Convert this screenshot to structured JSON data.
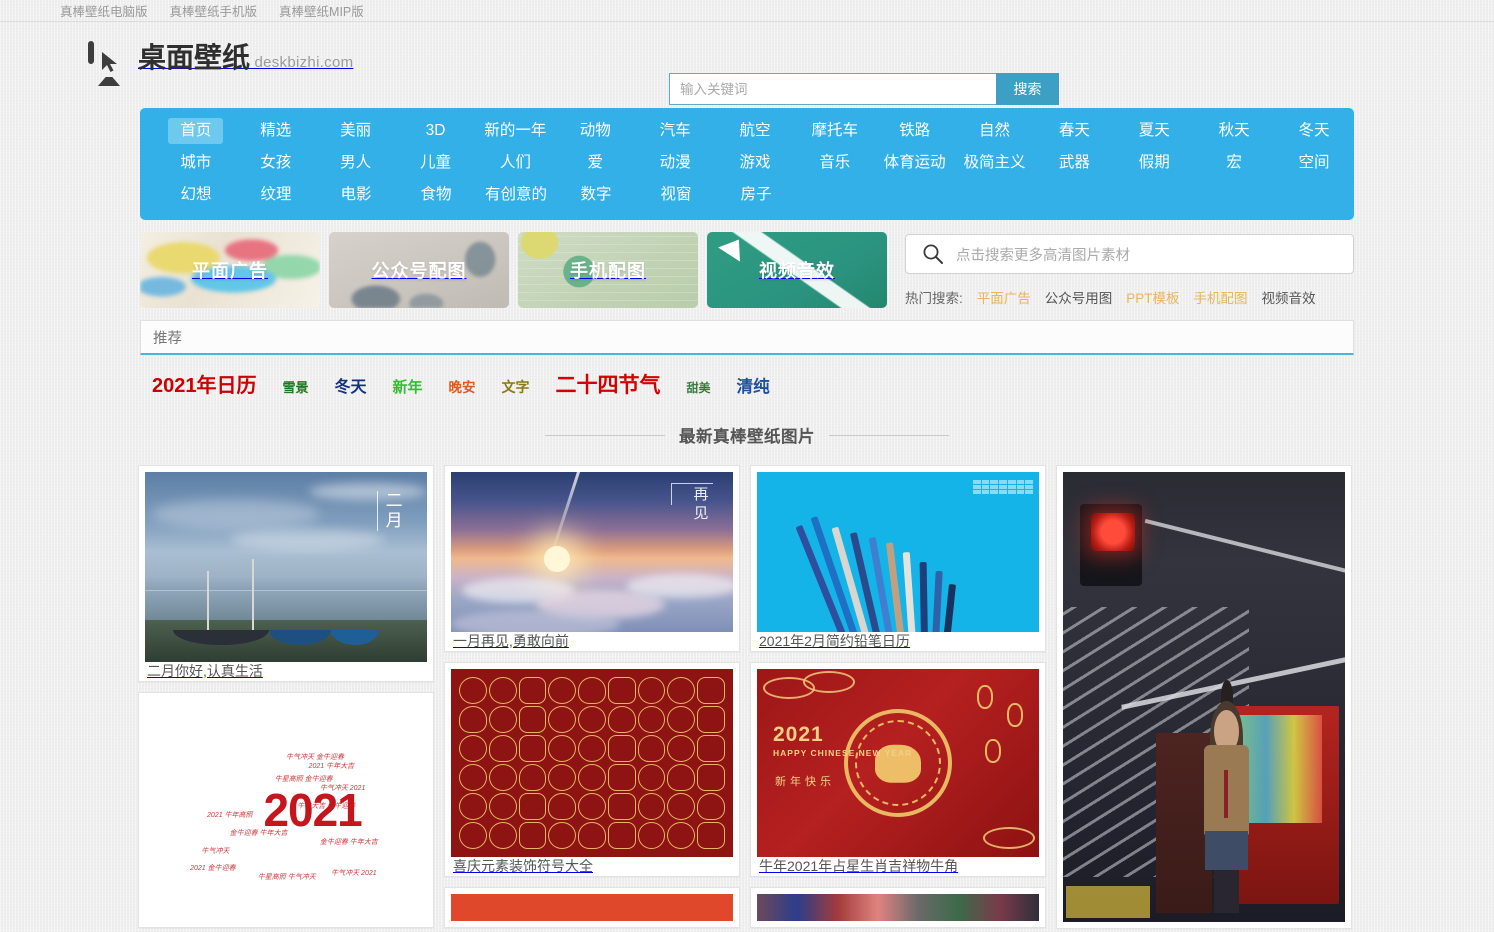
{
  "topbar": {
    "links": [
      {
        "label": "真棒壁纸电脑版"
      },
      {
        "label": "真棒壁纸手机版"
      },
      {
        "label": "真棒壁纸MIP版"
      }
    ]
  },
  "header": {
    "logo_title": "桌面壁纸",
    "logo_sub": "deskbizhi.com",
    "search": {
      "placeholder": "输入关键词",
      "value": "",
      "button_label": "搜索"
    }
  },
  "nav": {
    "rows": [
      [
        {
          "label": "首页",
          "active": true
        },
        {
          "label": "精选",
          "active": false
        },
        {
          "label": "美丽",
          "active": false
        },
        {
          "label": "3D",
          "active": false
        },
        {
          "label": "新的一年",
          "active": false
        },
        {
          "label": "动物",
          "active": false
        },
        {
          "label": "汽车",
          "active": false
        },
        {
          "label": "航空",
          "active": false
        },
        {
          "label": "摩托车",
          "active": false
        },
        {
          "label": "铁路",
          "active": false
        },
        {
          "label": "自然",
          "active": false
        },
        {
          "label": "春天",
          "active": false
        },
        {
          "label": "夏天",
          "active": false
        },
        {
          "label": "秋天",
          "active": false
        },
        {
          "label": "冬天",
          "active": false
        }
      ],
      [
        {
          "label": "城市",
          "active": false
        },
        {
          "label": "女孩",
          "active": false
        },
        {
          "label": "男人",
          "active": false
        },
        {
          "label": "儿童",
          "active": false
        },
        {
          "label": "人们",
          "active": false
        },
        {
          "label": "爱",
          "active": false
        },
        {
          "label": "动漫",
          "active": false
        },
        {
          "label": "游戏",
          "active": false
        },
        {
          "label": "音乐",
          "active": false
        },
        {
          "label": "体育运动",
          "active": false
        },
        {
          "label": "极简主义",
          "active": false
        },
        {
          "label": "武器",
          "active": false
        },
        {
          "label": "假期",
          "active": false
        },
        {
          "label": "宏",
          "active": false
        },
        {
          "label": "空间",
          "active": false
        }
      ],
      [
        {
          "label": "幻想",
          "active": false
        },
        {
          "label": "纹理",
          "active": false
        },
        {
          "label": "电影",
          "active": false
        },
        {
          "label": "食物",
          "active": false
        },
        {
          "label": "有创意的",
          "active": false
        },
        {
          "label": "数字",
          "active": false
        },
        {
          "label": "视窗",
          "active": false
        },
        {
          "label": "房子",
          "active": false
        }
      ]
    ]
  },
  "promo": {
    "cards": [
      {
        "label": "平面广告"
      },
      {
        "label": "公众号配图"
      },
      {
        "label": "手机配图"
      },
      {
        "label": "视频音效"
      }
    ],
    "search_placeholder": "点击搜索更多高清图片素材",
    "hot_label": "热门搜索:",
    "hot_items": [
      {
        "label": "平面广告",
        "color": "#e8b55b"
      },
      {
        "label": "公众号用图",
        "color": "#555555"
      },
      {
        "label": "PPT模板",
        "color": "#e8b55b"
      },
      {
        "label": "手机配图",
        "color": "#e8b55b"
      },
      {
        "label": "视频音效",
        "color": "#555555"
      }
    ]
  },
  "recommend": {
    "box_label": "推荐",
    "tags": [
      {
        "label": "2021年日历",
        "color": "#cc0000",
        "size": "20px",
        "weight": "700"
      },
      {
        "label": "雪景",
        "color": "#1e7a1e",
        "size": "13px",
        "weight": "700"
      },
      {
        "label": "冬天",
        "color": "#14317f",
        "size": "16px",
        "weight": "700"
      },
      {
        "label": "新年",
        "color": "#2fbf2f",
        "size": "15px",
        "weight": "700"
      },
      {
        "label": "晚安",
        "color": "#e05a20",
        "size": "13.5px",
        "weight": "700"
      },
      {
        "label": "文字",
        "color": "#8a7a12",
        "size": "14px",
        "weight": "700"
      },
      {
        "label": "二十四节气",
        "color": "#d40000",
        "size": "21px",
        "weight": "700"
      },
      {
        "label": "甜美",
        "color": "#3d7a3d",
        "size": "12px",
        "weight": "700"
      },
      {
        "label": "清纯",
        "color": "#1d4fa0",
        "size": "16.5px",
        "weight": "700"
      }
    ]
  },
  "section": {
    "title": "最新真棒壁纸图片"
  },
  "gallery": {
    "columns": [
      {
        "items": [
          {
            "caption": "二月你好,认真生活",
            "art": "sea",
            "vertical_text": "二月",
            "has_caption": true
          },
          {
            "caption": "",
            "art": "word-ox",
            "has_caption": false
          }
        ]
      },
      {
        "items": [
          {
            "caption": "一月再见,勇敢向前",
            "art": "sky",
            "vertical_text": "再见",
            "has_caption": true
          },
          {
            "caption": "喜庆元素装饰符号大全",
            "art": "red-symbols",
            "has_caption": true
          },
          {
            "caption": "",
            "art": "orange",
            "has_caption": false
          }
        ]
      },
      {
        "items": [
          {
            "caption": "2021年2月简约铅笔日历",
            "art": "pencil",
            "has_caption": true
          },
          {
            "caption": "牛年2021年占星生肖吉祥物牛角",
            "art": "ox",
            "has_caption": true
          },
          {
            "caption": "",
            "art": "collage",
            "has_caption": false
          }
        ]
      },
      {
        "items": [
          {
            "caption": "",
            "art": "night",
            "has_caption": false
          }
        ]
      }
    ]
  },
  "art_text": {
    "ox_year": "2021",
    "ox_happy": "HAPPY CHINESE NEW YEAR",
    "ox_xinnian": "新年快乐",
    "word_ox_year": "2021"
  }
}
